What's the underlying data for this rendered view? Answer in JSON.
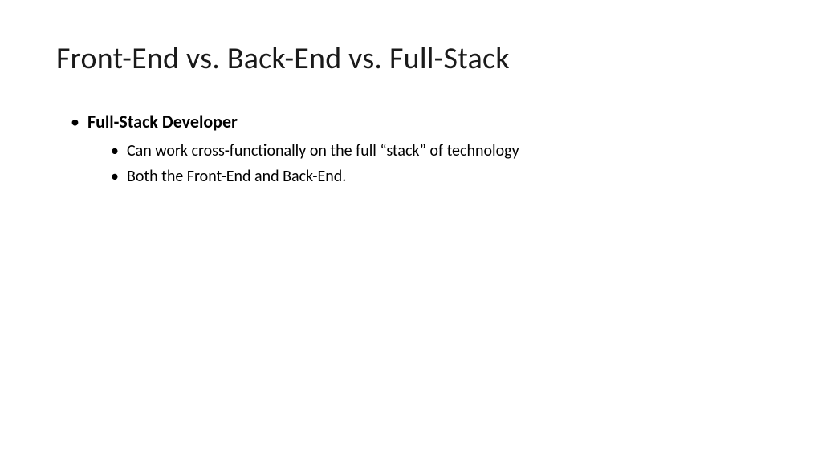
{
  "slide": {
    "title": "Front-End vs. Back-End vs. Full-Stack",
    "bullets": [
      {
        "text": "Full-Stack Developer",
        "subbullets": [
          "Can work cross-functionally on the full “stack” of technology",
          "Both the Front-End and Back-End."
        ]
      }
    ]
  }
}
